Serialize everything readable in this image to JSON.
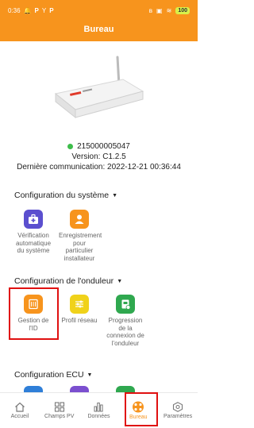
{
  "status_bar": {
    "time": "0:36",
    "left_icons": [
      "notification-icon",
      "p-icon",
      "y-icon",
      "p-icon"
    ],
    "right_icons": [
      "bluetooth-icon",
      "nfc-icon",
      "wifi-icon"
    ],
    "battery": "100"
  },
  "header": {
    "title": "Bureau"
  },
  "device": {
    "serial": "215000005047",
    "version": "Version: C1.2.5",
    "last_comm": "Dernière communication: 2022-12-21 00:36:44",
    "status_color": "#3dbd4a"
  },
  "sections": {
    "system": {
      "title": "Configuration du système",
      "tiles": [
        {
          "label": "Vérification automatique du système",
          "icon": "medical-kit-icon",
          "color": "#5b4fcf"
        },
        {
          "label": "Enregistrement pour particulier installateur",
          "icon": "user-icon",
          "color": "#f7941d"
        }
      ]
    },
    "inverter": {
      "title": "Configuration de l'onduleur",
      "tiles": [
        {
          "label": "Gestion de l'ID",
          "icon": "id-card-icon",
          "color": "#f7941d"
        },
        {
          "label": "Profil réseau",
          "icon": "sliders-icon",
          "color": "#f0d21a"
        },
        {
          "label": "Progression de la connexion de l'onduleur",
          "icon": "inverter-icon",
          "color": "#2fa84f"
        }
      ]
    },
    "ecu": {
      "title": "Configuration ECU",
      "tiles": [
        {
          "icon": "ecu-blue-icon",
          "color": "#2f7fd8"
        },
        {
          "icon": "ecu-purple-icon",
          "color": "#7b4fcf"
        },
        {
          "icon": "ecu-green-icon",
          "color": "#2fa84f"
        }
      ]
    }
  },
  "tabs": [
    {
      "label": "Accueil",
      "icon": "home-icon"
    },
    {
      "label": "Champs PV",
      "icon": "grid-icon"
    },
    {
      "label": "Données",
      "icon": "bar-chart-icon"
    },
    {
      "label": "Bureau",
      "icon": "bureau-icon",
      "active": true
    },
    {
      "label": "Paramètres",
      "icon": "settings-icon"
    }
  ],
  "colors": {
    "accent": "#f7941d",
    "highlight": "#e01010"
  }
}
